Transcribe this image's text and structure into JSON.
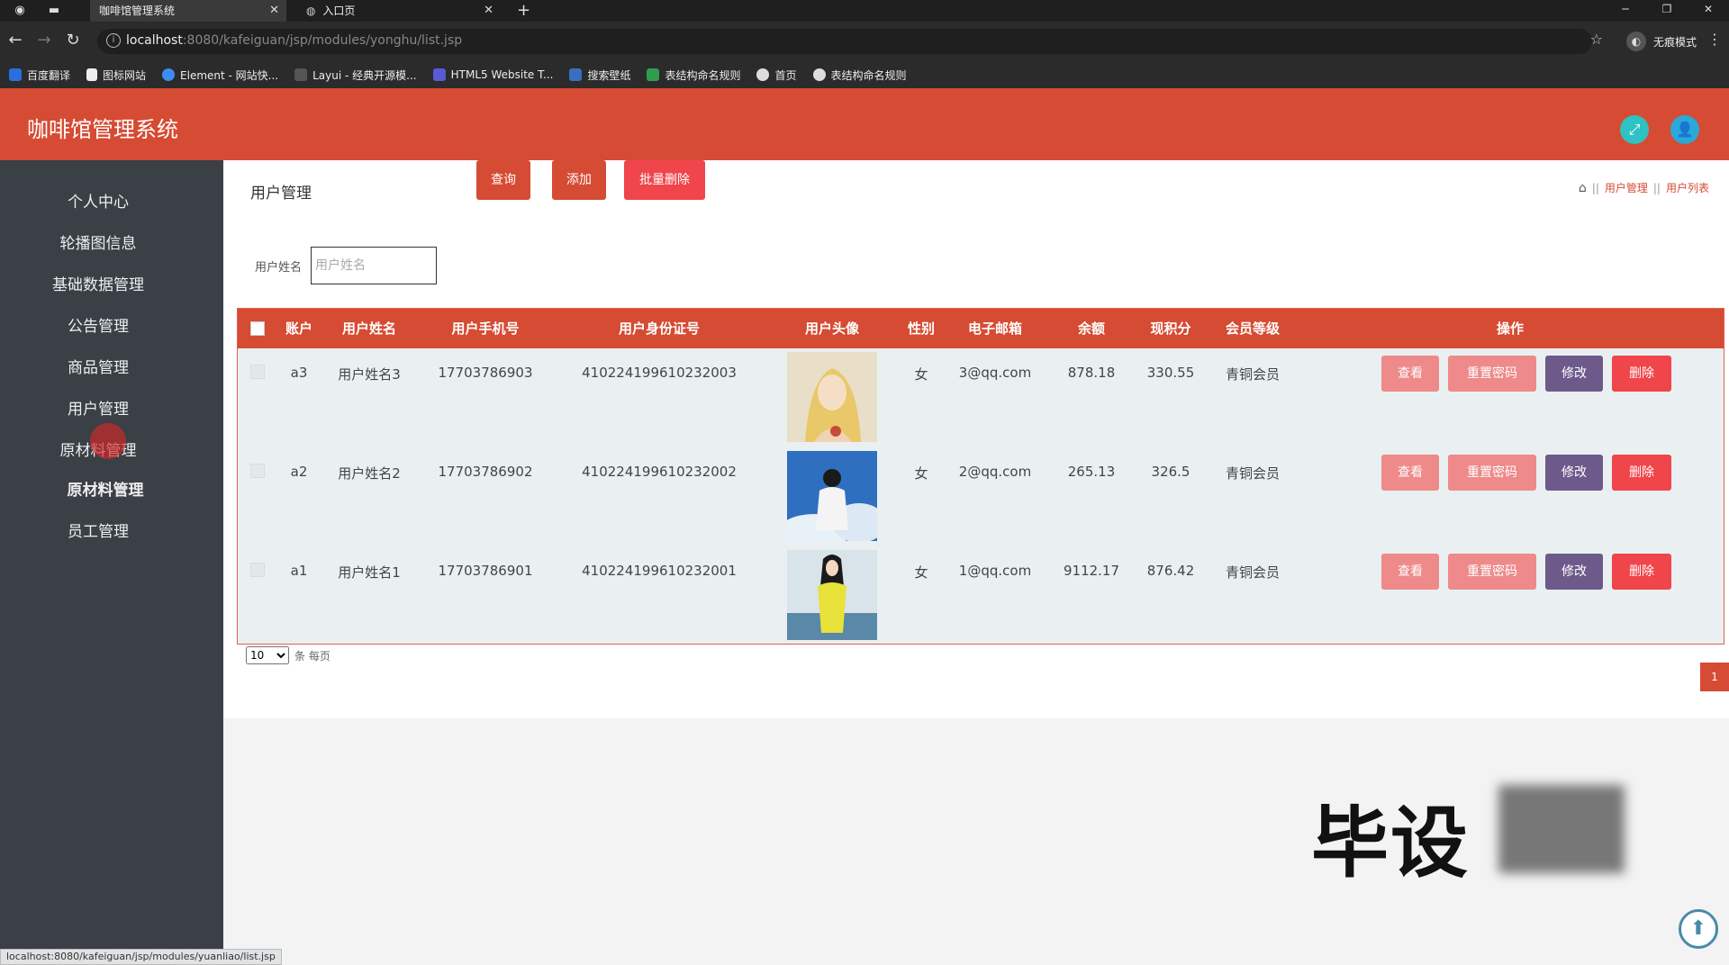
{
  "browser": {
    "tabs": [
      {
        "label": "咖啡馆管理系统",
        "active": true
      },
      {
        "label": "入口页",
        "active": false
      }
    ],
    "url_host": "localhost",
    "url_path": ":8080/kafeiguan/jsp/modules/yonghu/list.jsp",
    "profile_label": "无痕模式",
    "bookmarks": [
      "百度翻译",
      "图标网站",
      "Element - 网站快...",
      "Layui - 经典开源模...",
      "HTML5 Website T...",
      "搜索壁纸",
      "表结构命名规则",
      "首页",
      "表结构命名规则"
    ],
    "status_url": "localhost:8080/kafeiguan/jsp/modules/yuanliao/list.jsp"
  },
  "app": {
    "title": "咖啡馆管理系统",
    "colors": {
      "brand": "#d64b33",
      "sidebar": "#3a4046",
      "fullscreen_btn": "#2fc2c2",
      "user_btn": "#2aa9d8"
    }
  },
  "sidebar": {
    "items": [
      "个人中心",
      "轮播图信息",
      "基础数据管理",
      "公告管理",
      "商品管理",
      "用户管理",
      "原材料管理",
      "原材料管理",
      "员工管理"
    ]
  },
  "main": {
    "page_title": "用户管理",
    "breadcrumbs": [
      "用户管理",
      "用户列表"
    ],
    "search": {
      "label": "用户姓名",
      "placeholder": "用户姓名",
      "value": ""
    },
    "buttons": {
      "query": "查询",
      "add": "添加",
      "batch_delete": "批量删除"
    },
    "table": {
      "headers": [
        "账户",
        "用户姓名",
        "用户手机号",
        "用户身份证号",
        "用户头像",
        "性别",
        "电子邮箱",
        "余额",
        "现积分",
        "会员等级",
        "操作"
      ],
      "rows": [
        {
          "account": "a3",
          "name": "用户姓名3",
          "phone": "17703786903",
          "id_card": "410224199610232003",
          "gender": "女",
          "email": "3@qq.com",
          "balance": "878.18",
          "points": "330.55",
          "level": "青铜会员"
        },
        {
          "account": "a2",
          "name": "用户姓名2",
          "phone": "17703786902",
          "id_card": "410224199610232002",
          "gender": "女",
          "email": "2@qq.com",
          "balance": "265.13",
          "points": "326.5",
          "level": "青铜会员"
        },
        {
          "account": "a1",
          "name": "用户姓名1",
          "phone": "17703786901",
          "id_card": "410224199610232001",
          "gender": "女",
          "email": "1@qq.com",
          "balance": "9112.17",
          "points": "876.42",
          "level": "青铜会员"
        }
      ],
      "row_actions": {
        "view": "查看",
        "reset_password": "重置密码",
        "edit": "修改",
        "delete": "删除"
      }
    },
    "pager": {
      "page_size": "10",
      "per_page_label": "条 每页",
      "current_page": "1"
    }
  },
  "watermark": "毕设"
}
